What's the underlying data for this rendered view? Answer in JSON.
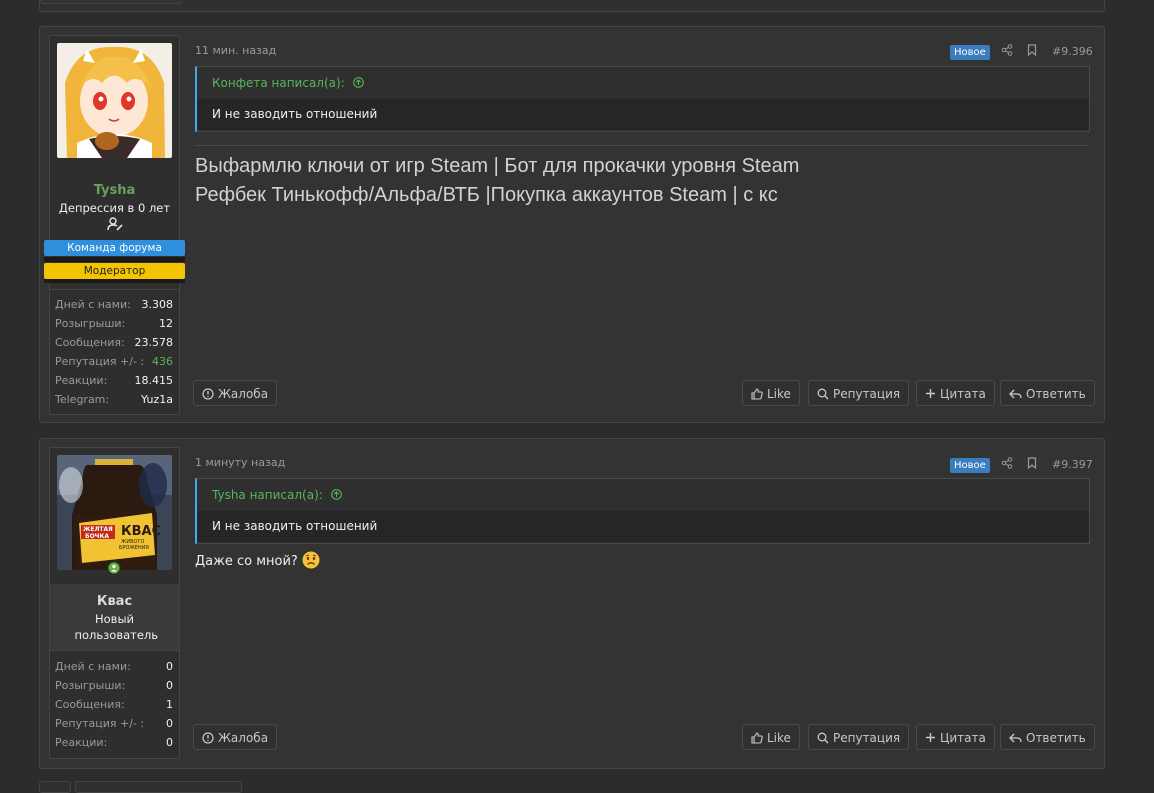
{
  "posts": [
    {
      "time": "11 мин. назад",
      "badge": "Новое",
      "number": "#9.396",
      "username": "Tysha",
      "username_color": "#66a35a",
      "user_title": "Депрессия в 0 лет",
      "banners": [
        "Команда форума",
        "Модератор"
      ],
      "stats": [
        {
          "label": "Дней с нами:",
          "value": "3.308"
        },
        {
          "label": "Розыгрыши:",
          "value": "12"
        },
        {
          "label": "Сообщения:",
          "value": "23.578"
        },
        {
          "label": "Репутация +/- :",
          "value": "436"
        },
        {
          "label": "Реакции:",
          "value": "18.415"
        },
        {
          "label": "Telegram:",
          "value": "Yuz1a"
        }
      ],
      "quote_author": "Конфета написал(а):",
      "quote_text": "И не заводить отношений",
      "signature_line1": "Выфармлю ключи от игр Steam | Бот для прокачки уровня Steam",
      "signature_line2": "Рефбек Тинькофф/Альфа/ВТБ |Покупка аккаунтов Steam | с кс",
      "actions": {
        "report": "Жалоба",
        "like": "Like",
        "reputation": "Репутация",
        "quote": "Цитата",
        "reply": "Ответить"
      }
    },
    {
      "time": "1 минуту назад",
      "badge": "Новое",
      "number": "#9.397",
      "username": "Квас",
      "username_color": "#d9d9d9",
      "user_title": "Новый пользователь",
      "stats": [
        {
          "label": "Дней с нами:",
          "value": "0"
        },
        {
          "label": "Розыгрыши:",
          "value": "0"
        },
        {
          "label": "Сообщения:",
          "value": "1"
        },
        {
          "label": "Репутация +/- :",
          "value": "0"
        },
        {
          "label": "Реакции:",
          "value": "0"
        }
      ],
      "quote_author": "Tysha написал(а):",
      "quote_text": "И не заводить отношений",
      "message": "Даже со мной?",
      "actions": {
        "report": "Жалоба",
        "like": "Like",
        "reputation": "Репутация",
        "quote": "Цитата",
        "reply": "Ответить"
      }
    }
  ],
  "avatar_label": [
    "ЖЕЛТАЯ",
    "БОЧКА",
    "КВАС",
    "ЖИВОГО",
    "БРОЖЕНИЯ"
  ],
  "colors": {
    "accent": "#47a7eb",
    "positive": "#58b55a",
    "badge": "#3a7dbf",
    "team_banner": "#2f8fdd",
    "moderator_banner": "#f5c400"
  }
}
